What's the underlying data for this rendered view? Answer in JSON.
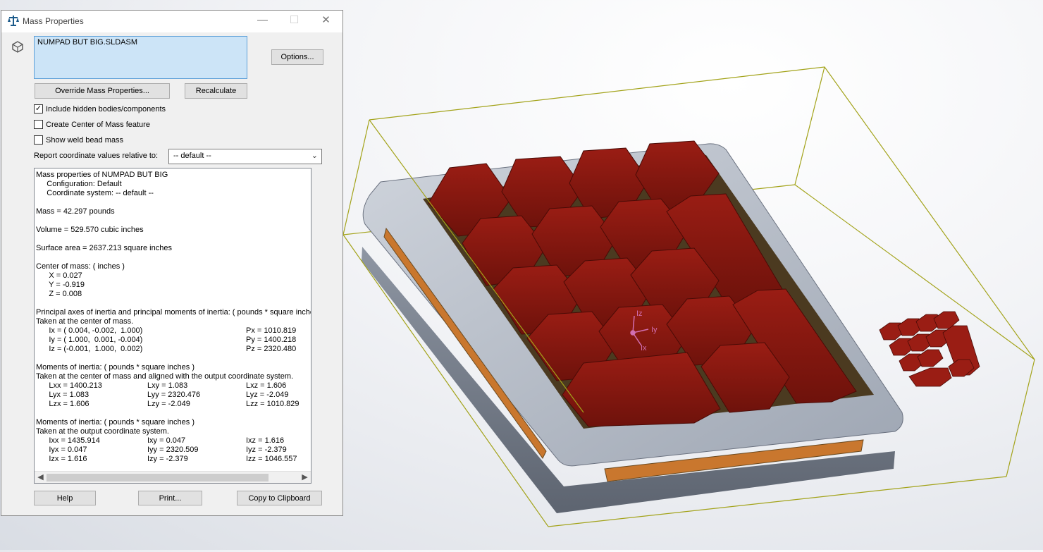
{
  "dialog": {
    "title": "Mass Properties",
    "window_buttons": {
      "minimize": "—",
      "maximize": "☐",
      "close": "✕"
    },
    "selection_value": "NUMPAD BUT BIG.SLDASM",
    "options_label": "Options...",
    "override_label": "Override Mass Properties...",
    "recalculate_label": "Recalculate",
    "checkboxes": [
      {
        "label": "Include hidden bodies/components",
        "checked": true
      },
      {
        "label": "Create Center of Mass feature",
        "checked": false
      },
      {
        "label": "Show weld bead mass",
        "checked": false
      }
    ],
    "report_label": "Report coordinate values relative to:",
    "report_value": "-- default --",
    "help_label": "Help",
    "print_label": "Print...",
    "copy_label": "Copy to Clipboard"
  },
  "results": {
    "lines": [
      "Mass properties of NUMPAD BUT BIG",
      "     Configuration: Default",
      "     Coordinate system: -- default --",
      "",
      "Mass = 42.297 pounds",
      "",
      "Volume = 529.570 cubic inches",
      "",
      "Surface area = 2637.213 square inches",
      "",
      "Center of mass: ( inches )",
      "      X = 0.027",
      "      Y = -0.919",
      "      Z = 0.008",
      "",
      "Principal axes of inertia and principal moments of inertia: ( pounds * square inches )",
      "Taken at the center of mass.",
      [
        "      Ix = ( 0.004, -0.002,  1.000)",
        "Px = 1010.819"
      ],
      [
        "      Iy = ( 1.000,  0.001, -0.004)",
        "Py = 1400.218"
      ],
      [
        "      Iz = (-0.001,  1.000,  0.002)",
        "Pz = 2320.480"
      ],
      "",
      "Moments of inertia: ( pounds * square inches )",
      "Taken at the center of mass and aligned with the output coordinate system.",
      [
        "      Lxx = 1400.213",
        "Lxy = 1.083",
        "Lxz = 1.606"
      ],
      [
        "      Lyx = 1.083",
        "Lyy = 2320.476",
        "Lyz = -2.049"
      ],
      [
        "      Lzx = 1.606",
        "Lzy = -2.049",
        "Lzz = 1010.829"
      ],
      "",
      "Moments of inertia: ( pounds * square inches )",
      "Taken at the output coordinate system.",
      [
        "      Ixx = 1435.914",
        "Ixy = 0.047",
        "Ixz = 1.616"
      ],
      [
        "      Iyx = 0.047",
        "Iyy = 2320.509",
        "Iyz = -2.379"
      ],
      [
        "      Izx = 1.616",
        "Izy = -2.379",
        "Izz = 1046.557"
      ]
    ]
  },
  "viewport": {
    "triad": {
      "z": "Iz",
      "y": "Iy",
      "x": "Ix"
    },
    "colors": {
      "keycap": "#8f1a12",
      "case": "#b9c0cc",
      "bbox": "#9a9a1a",
      "triad": "#d16fb2"
    }
  }
}
